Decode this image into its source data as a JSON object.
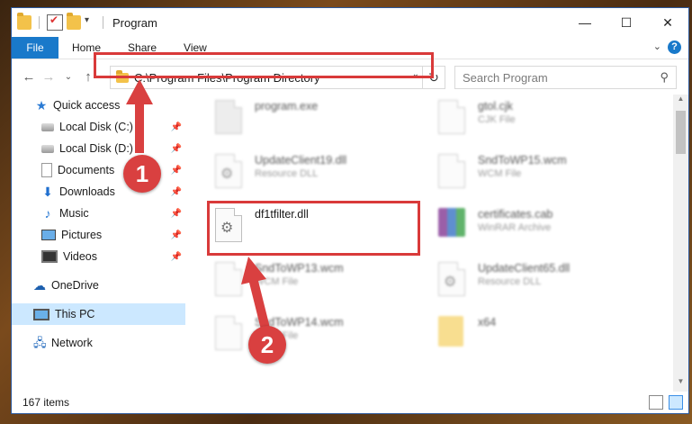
{
  "window": {
    "title": "Program",
    "controls": {
      "minimize": "—",
      "maximize": "☐",
      "close": "✕"
    }
  },
  "ribbon": {
    "file_tab": "File",
    "tabs": [
      "Home",
      "Share",
      "View"
    ],
    "help": "?"
  },
  "address_bar": {
    "path": "C:\\Program Files\\Program Directory",
    "refresh": "↻"
  },
  "search": {
    "placeholder": "Search Program",
    "icon": "search-icon"
  },
  "sidebar": {
    "items": [
      {
        "label": "Quick access",
        "icon": "star-icon"
      },
      {
        "label": "Local Disk (C:)",
        "icon": "drive-icon"
      },
      {
        "label": "Local Disk (D:)",
        "icon": "drive-icon"
      },
      {
        "label": "Documents",
        "icon": "documents-icon"
      },
      {
        "label": "Downloads",
        "icon": "downloads-icon"
      },
      {
        "label": "Music",
        "icon": "music-icon"
      },
      {
        "label": "Pictures",
        "icon": "pictures-icon"
      },
      {
        "label": "Videos",
        "icon": "videos-icon"
      },
      {
        "label": "OneDrive",
        "icon": "cloud-icon"
      },
      {
        "label": "This PC",
        "icon": "computer-icon"
      },
      {
        "label": "Network",
        "icon": "network-icon"
      }
    ]
  },
  "files": [
    {
      "name": "program.exe",
      "type": ""
    },
    {
      "name": "gtol.cjk",
      "type": "CJK File"
    },
    {
      "name": "UpdateClient19.dll",
      "type": "Resource DLL"
    },
    {
      "name": "SndToWP15.wcm",
      "type": "WCM File"
    },
    {
      "name": "df1tfilter.dll",
      "type": ""
    },
    {
      "name": "certificates.cab",
      "type": "WinRAR Archive"
    },
    {
      "name": "SndToWP13.wcm",
      "type": "WCM File"
    },
    {
      "name": "UpdateClient65.dll",
      "type": "Resource DLL"
    },
    {
      "name": "SndToWP14.wcm",
      "type": "WCM File"
    },
    {
      "name": "x64",
      "type": ""
    }
  ],
  "status": {
    "item_count": "167 items"
  },
  "callouts": {
    "step1": "1",
    "step2": "2"
  },
  "colors": {
    "accent": "#1979ca",
    "highlight": "#d93a3a",
    "selection": "#cce8ff"
  }
}
